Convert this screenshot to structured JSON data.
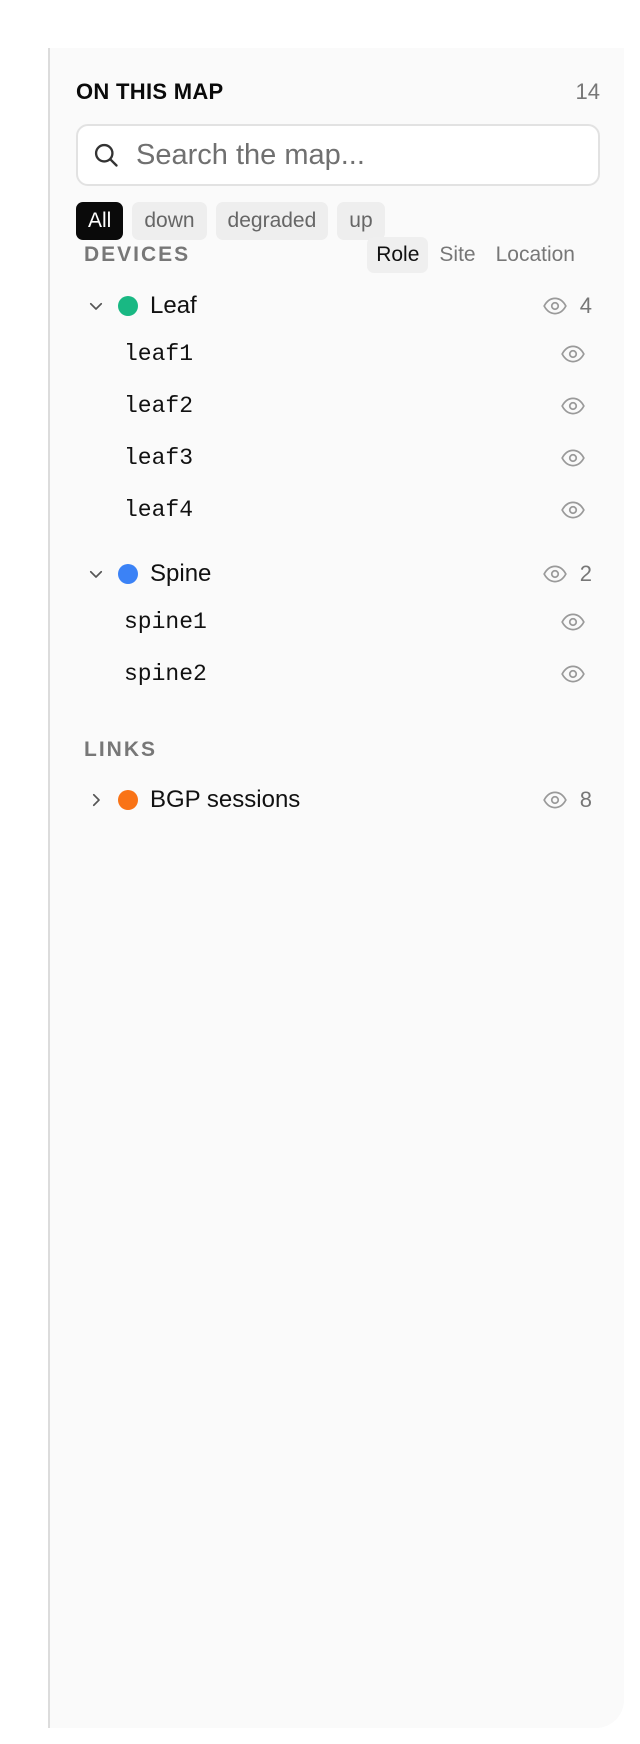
{
  "header": {
    "title": "ON THIS MAP",
    "count": "14"
  },
  "search": {
    "placeholder": "Search the map..."
  },
  "filters": [
    {
      "label": "All",
      "active": true
    },
    {
      "label": "down",
      "active": false
    },
    {
      "label": "degraded",
      "active": false
    },
    {
      "label": "up",
      "active": false
    }
  ],
  "devices": {
    "label": "DEVICES",
    "group_tabs": [
      {
        "label": "Role",
        "active": true
      },
      {
        "label": "Site",
        "active": false
      },
      {
        "label": "Location",
        "active": false
      }
    ],
    "groups": [
      {
        "name": "Leaf",
        "count": "4",
        "color": "#19b883",
        "expanded": true,
        "items": [
          "leaf1",
          "leaf2",
          "leaf3",
          "leaf4"
        ]
      },
      {
        "name": "Spine",
        "count": "2",
        "color": "#3b82f6",
        "expanded": true,
        "items": [
          "spine1",
          "spine2"
        ]
      }
    ]
  },
  "links": {
    "label": "LINKS",
    "groups": [
      {
        "name": "BGP sessions",
        "count": "8",
        "color": "#f97316",
        "expanded": false
      }
    ]
  },
  "icons": {
    "search": "search-icon",
    "eye": "eye-icon",
    "chevron_down": "chevron-down-icon",
    "chevron_right": "chevron-right-icon"
  }
}
